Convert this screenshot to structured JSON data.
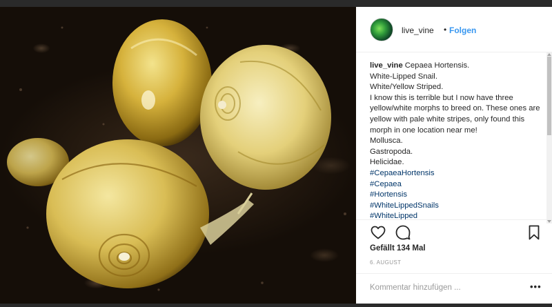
{
  "post": {
    "username": "live_vine",
    "separator": "•",
    "follow_label": "Folgen",
    "caption_username": "live_vine",
    "caption_lines": [
      "Cepaea Hortensis.",
      "White-Lipped Snail.",
      "White/Yellow Striped.",
      "I know this is terrible but I now have three yellow/white morphs to breed on. These ones are yellow with pale white stripes, only found this morph in one location near me!",
      "Mollusca.",
      "Gastropoda.",
      "Helicidae."
    ],
    "hashtags": [
      "#CepaeaHortensis",
      "#Cepaea",
      "#Hortensis",
      "#WhiteLippedSnails",
      "#WhiteLipped"
    ],
    "likes_text": "Gefällt 134 Mal",
    "date_text": "6. AUGUST",
    "comment_placeholder": "Kommentar hinzufügen ...",
    "more_label": "•••"
  },
  "icons": {
    "like": "heart-icon",
    "comment": "comment-bubble-icon",
    "save": "bookmark-icon",
    "more": "more-options-icon"
  },
  "colors": {
    "link_blue": "#3897f0",
    "hashtag_blue": "#003569",
    "text": "#262626",
    "muted": "#999999",
    "border": "#efefef"
  }
}
